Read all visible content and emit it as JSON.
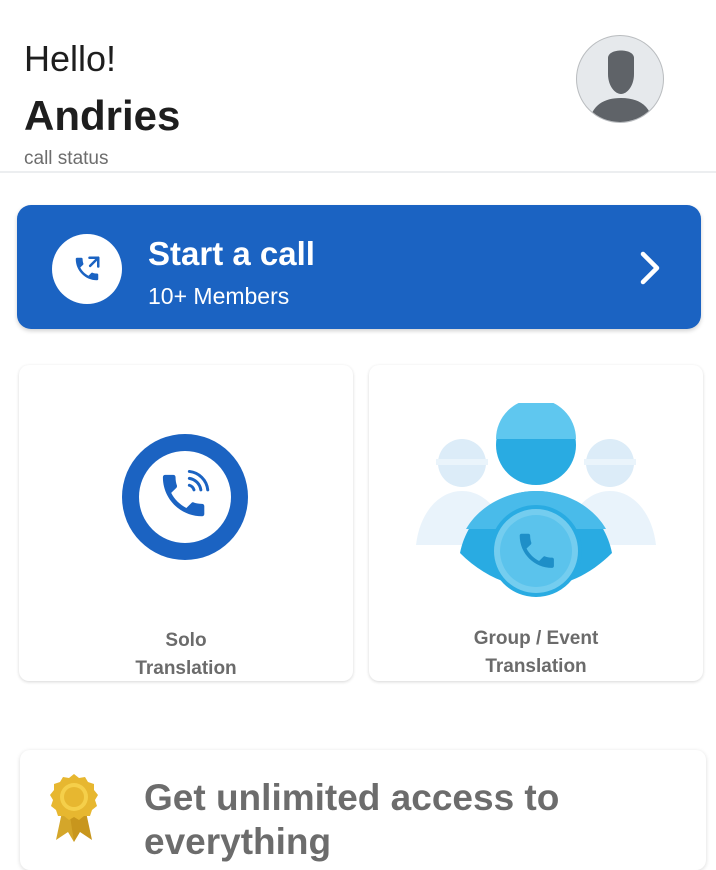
{
  "header": {
    "greeting": "Hello!",
    "username": "Andries",
    "call_status": "call status",
    "avatar_icon": "user-silhouette-icon"
  },
  "start_call": {
    "title": "Start a call",
    "subtitle": "10+ Members",
    "icon": "phone-call-icon",
    "chevron": "chevron-right-icon",
    "color": "#1b63c2"
  },
  "cards": {
    "solo": {
      "line1": "Solo",
      "line2": "Translation",
      "icon": "phone-ringing-icon"
    },
    "group": {
      "line1": "Group / Event",
      "line2": "Translation",
      "icon": "group-call-icon"
    }
  },
  "promo": {
    "text": "Get unlimited access to everything",
    "icon": "award-badge-icon"
  }
}
